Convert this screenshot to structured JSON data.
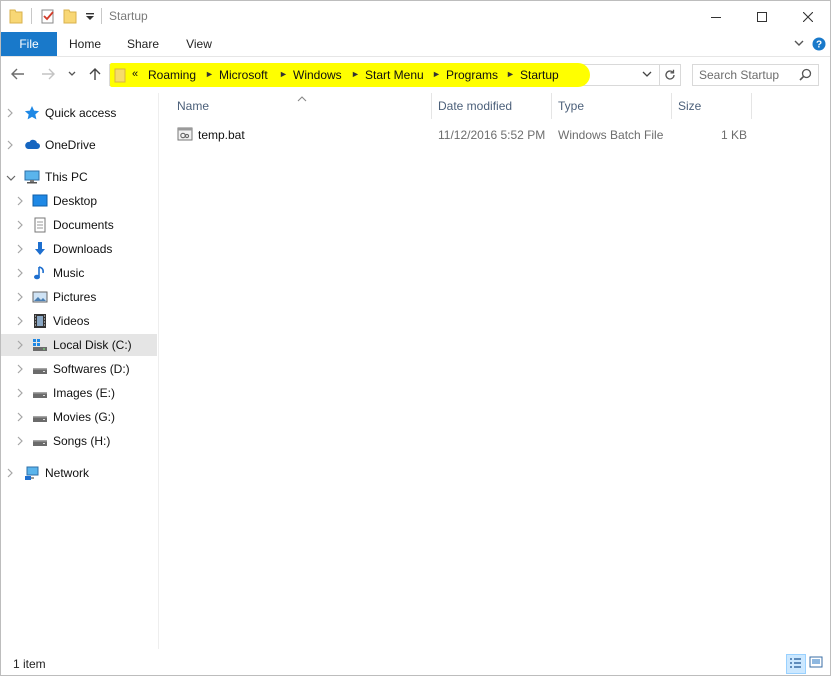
{
  "window": {
    "title": "Startup",
    "controls": [
      "minimize-icon",
      "maximize-icon",
      "close-icon"
    ]
  },
  "ribbon": {
    "tabs": [
      {
        "label": "File",
        "active": true
      },
      {
        "label": "Home"
      },
      {
        "label": "Share"
      },
      {
        "label": "View"
      }
    ]
  },
  "navigation": {
    "back_icon": "arrow-left-icon",
    "forward_icon": "arrow-right-icon",
    "recent_icon": "chevron-down-icon",
    "up_icon": "arrow-up-icon",
    "overflow": "«",
    "breadcrumb": [
      "Roaming",
      "Microsoft",
      "Windows",
      "Start Menu",
      "Programs",
      "Startup"
    ],
    "highlight_color": "#ffff00"
  },
  "search": {
    "placeholder": "Search Startup"
  },
  "sidebar": {
    "items": [
      {
        "label": "Quick access",
        "icon": "star-icon"
      },
      {
        "label": "OneDrive",
        "icon": "cloud-icon"
      },
      {
        "label": "This PC",
        "icon": "computer-icon",
        "expanded": true
      },
      {
        "label": "Desktop",
        "icon": "desktop-icon"
      },
      {
        "label": "Documents",
        "icon": "documents-icon"
      },
      {
        "label": "Downloads",
        "icon": "download-icon"
      },
      {
        "label": "Music",
        "icon": "music-icon"
      },
      {
        "label": "Pictures",
        "icon": "pictures-icon"
      },
      {
        "label": "Videos",
        "icon": "videos-icon"
      },
      {
        "label": "Local Disk (C:)",
        "icon": "system-drive-icon",
        "selected": true
      },
      {
        "label": "Softwares (D:)",
        "icon": "drive-icon"
      },
      {
        "label": "Images (E:)",
        "icon": "drive-icon"
      },
      {
        "label": "Movies (G:)",
        "icon": "drive-icon"
      },
      {
        "label": "Songs (H:)",
        "icon": "drive-icon"
      },
      {
        "label": "Network",
        "icon": "network-icon"
      }
    ]
  },
  "file_list": {
    "columns": [
      "Name",
      "Date modified",
      "Type",
      "Size"
    ],
    "sort": {
      "column": "Name",
      "direction": "ascending"
    },
    "rows": [
      {
        "name": "temp.bat",
        "date_modified": "11/12/2016 5:52 PM",
        "type": "Windows Batch File",
        "size": "1 KB",
        "icon": "batch-file-icon"
      }
    ]
  },
  "status_bar": {
    "item_count": "1 item",
    "view_modes": [
      "details-view-icon",
      "large-icons-view-icon"
    ]
  },
  "colors": {
    "accent": "#1979ca",
    "selection": "#e5e5e5",
    "header_text": "#4c607a"
  }
}
